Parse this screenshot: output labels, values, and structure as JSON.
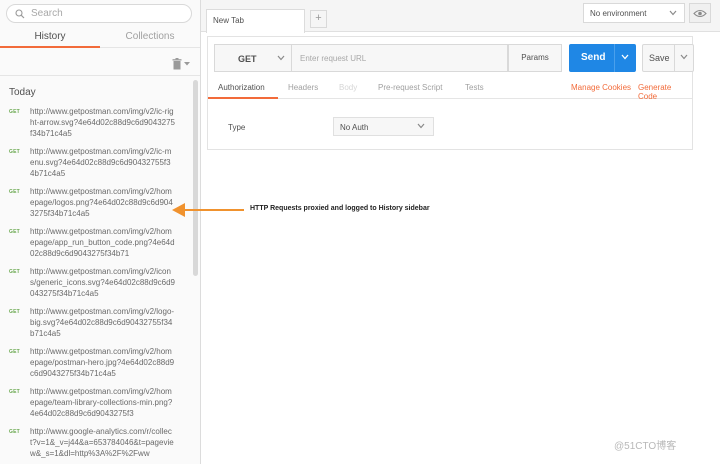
{
  "sidebar": {
    "search_placeholder": "Search",
    "tabs": [
      {
        "label": "History",
        "active": true
      },
      {
        "label": "Collections",
        "active": false
      }
    ],
    "section_title": "Today",
    "history": [
      {
        "method": "GET",
        "url": "http://www.getpostman.com/img/v2/ic-right-arrow.svg?4e64d02c88d9c6d9043275f34b71c4a5"
      },
      {
        "method": "GET",
        "url": "http://www.getpostman.com/img/v2/ic-menu.svg?4e64d02c88d9c6d90432755f34b71c4a5"
      },
      {
        "method": "GET",
        "url": "http://www.getpostman.com/img/v2/homepage/logos.png?4e64d02c88d9c6d9043275f34b71c4a5"
      },
      {
        "method": "GET",
        "url": "http://www.getpostman.com/img/v2/homepage/app_run_button_code.png?4e64d02c88d9c6d9043275f34b71"
      },
      {
        "method": "GET",
        "url": "http://www.getpostman.com/img/v2/icons/generic_icons.svg?4e64d02c88d9c6d9043275f34b71c4a5"
      },
      {
        "method": "GET",
        "url": "http://www.getpostman.com/img/v2/logo-big.svg?4e64d02c88d9c6d90432755f34b71c4a5"
      },
      {
        "method": "GET",
        "url": "http://www.getpostman.com/img/v2/homepage/postman-hero.jpg?4e64d02c88d9c6d9043275f34b71c4a5"
      },
      {
        "method": "GET",
        "url": "http://www.getpostman.com/img/v2/homepage/team-library-collections-min.png?4e64d02c88d9c6d9043275f3"
      },
      {
        "method": "GET",
        "url": "http://www.google-analytics.com/r/collect?v=1&_v=j44&a=653784046&t=pageview&_s=1&dl=http%3A%2F%2Fww"
      }
    ]
  },
  "main": {
    "tab_label": "New Tab",
    "add_tab": "+",
    "environment": "No environment",
    "method": "GET",
    "url_placeholder": "Enter request URL",
    "params_label": "Params",
    "send_label": "Send",
    "save_label": "Save",
    "subtabs": [
      {
        "label": "Authorization",
        "active": true
      },
      {
        "label": "Headers",
        "active": false
      },
      {
        "label": "Body",
        "active": false,
        "disabled": true
      },
      {
        "label": "Pre-request Script",
        "active": false
      },
      {
        "label": "Tests",
        "active": false
      }
    ],
    "manage_cookies": "Manage Cookies",
    "generate_code": "Generate Code",
    "auth_type_label": "Type",
    "auth_type_value": "No Auth"
  },
  "annotation": "HTTP Requests proxied and logged to History sidebar",
  "watermark": "@51CTO博客",
  "colors": {
    "accent": "#f26b3a",
    "send": "#1f87e5",
    "get": "#6aa84f"
  }
}
